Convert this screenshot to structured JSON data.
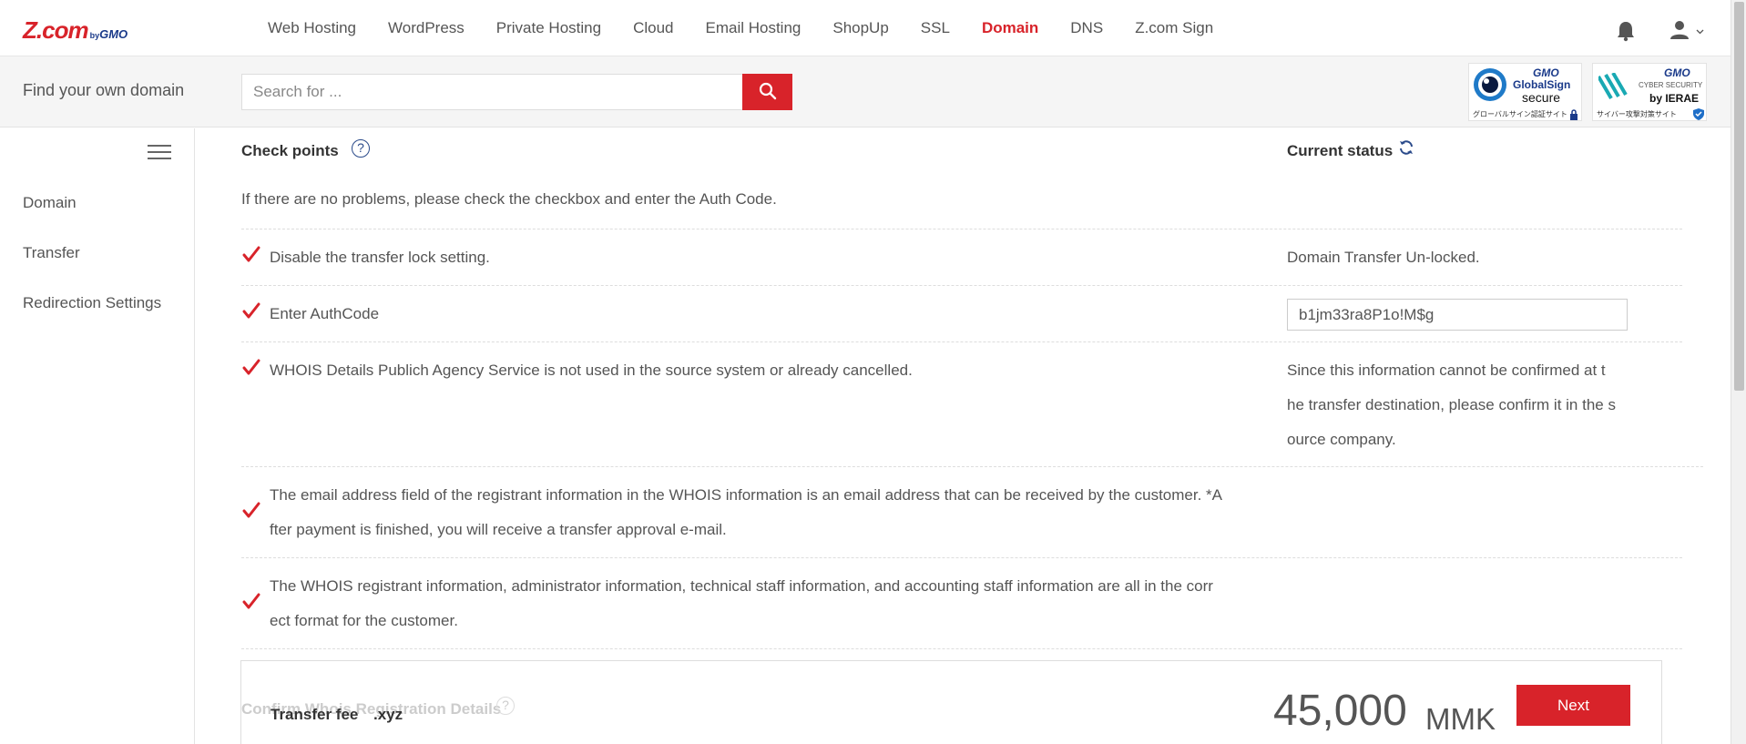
{
  "logo": {
    "main": "Z.com",
    "by": "by",
    "gmo": "GMO"
  },
  "nav": {
    "items": [
      "Web Hosting",
      "WordPress",
      "Private Hosting",
      "Cloud",
      "Email Hosting",
      "ShopUp",
      "SSL",
      "Domain",
      "DNS",
      "Z.com Sign"
    ],
    "active": "Domain"
  },
  "search": {
    "label": "Find your own domain",
    "placeholder": "Search for ...",
    "value": ""
  },
  "badges": {
    "globalsign": {
      "brand": "GMO",
      "line1": "GlobalSign",
      "line2": "secure",
      "caption": "グローバルサイン認証サイト"
    },
    "ierae": {
      "brand": "GMO",
      "line1": "CYBER SECURITY",
      "line2": "by IERAE",
      "caption": "サイバー攻撃対策サイト"
    }
  },
  "sidebar": {
    "items": [
      "Domain",
      "Transfer",
      "Redirection Settings"
    ]
  },
  "main": {
    "check_points": "Check points",
    "current_status": "Current status",
    "intro": "If there are no problems, please check the checkbox and enter the Auth Code.",
    "rows": [
      {
        "text": "Disable the transfer lock setting.",
        "status": "Domain Transfer Un-locked.",
        "checked": true
      },
      {
        "text": "Enter AuthCode",
        "auth_value": "b1jm33ra8P1o!M$g",
        "checked": true
      },
      {
        "text": "WHOIS Details Publich Agency Service is not used in the source system or already cancelled.",
        "status_lines": [
          "Since this information cannot be confirmed at t",
          "he transfer destination, please confirm it in the s",
          "ource company."
        ],
        "checked": true
      },
      {
        "text_lines": [
          "The email address field of the registrant information in the WHOIS information is an email address that can be received by the customer. *A",
          "fter payment is finished, you will receive a transfer approval e-mail."
        ],
        "checked": true
      },
      {
        "text_lines": [
          "The WHOIS registrant information, administrator information, technical staff information, and accounting staff information are all in the corr",
          "ect format for the customer."
        ],
        "checked": true
      }
    ],
    "whois_confirm": "Confirm Whois Registration Details",
    "fee": {
      "label": "Transfer fee",
      "tld": ".xyz",
      "price": "45,000",
      "currency": "MMK"
    },
    "next": "Next"
  },
  "colors": {
    "brand_red": "#d8232a",
    "gmo_blue": "#1a3a8a"
  }
}
